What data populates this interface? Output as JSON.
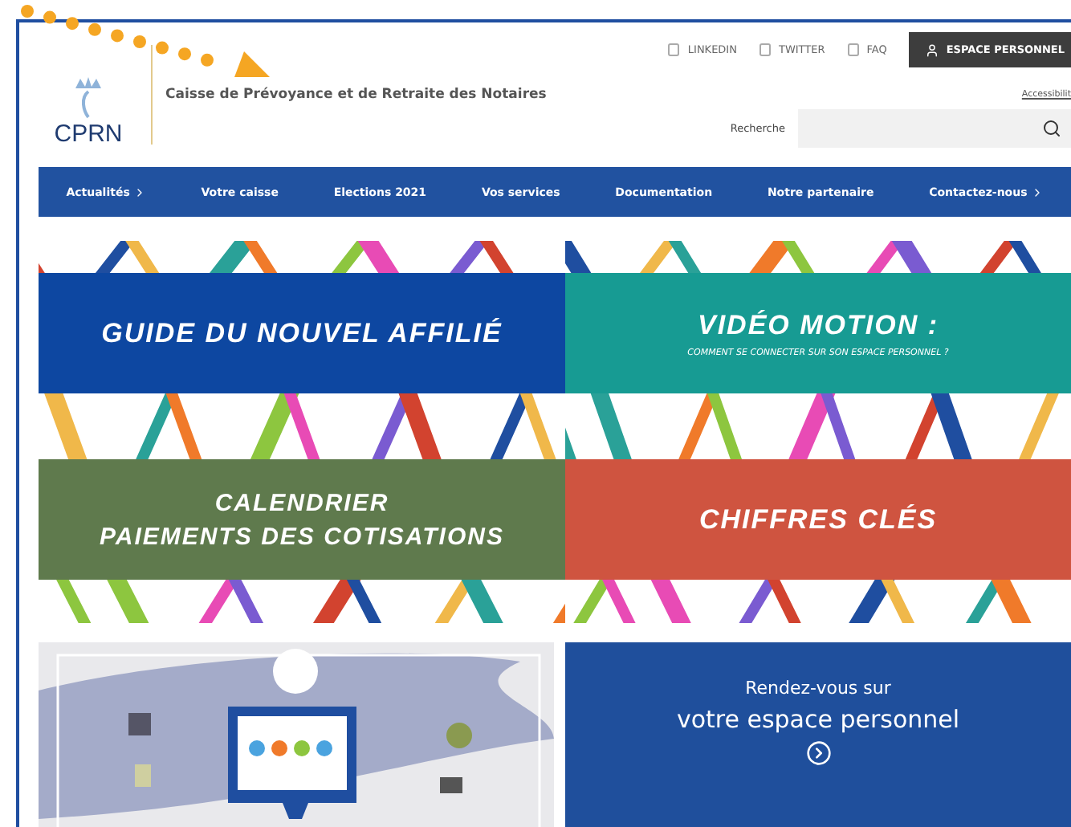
{
  "top_links": [
    {
      "label": "LINKEDIN"
    },
    {
      "label": "TWITTER"
    },
    {
      "label": "FAQ"
    }
  ],
  "account_button": {
    "label": "ESPACE PERSONNEL"
  },
  "logo": {
    "text": "CPRN"
  },
  "site_title": "Caisse de Prévoyance et de Retraite des Notaires",
  "accessibility_link": "Accessibilit",
  "search": {
    "label": "Recherche"
  },
  "nav": [
    {
      "label": "Actualités",
      "has_submenu": true
    },
    {
      "label": "Votre caisse",
      "has_submenu": false
    },
    {
      "label": "Elections 2021",
      "has_submenu": false
    },
    {
      "label": "Vos services",
      "has_submenu": false
    },
    {
      "label": "Documentation",
      "has_submenu": false
    },
    {
      "label": "Notre partenaire",
      "has_submenu": false
    },
    {
      "label": "Contactez-nous",
      "has_submenu": true
    }
  ],
  "tiles": [
    {
      "color": "#0d47a1",
      "lines": [
        "GUIDE DU NOUVEL AFFILIÉ"
      ]
    },
    {
      "color": "#179b93",
      "lines": [
        "VIDÉO MOTION :"
      ],
      "subtitle": "COMMENT SE CONNECTER SUR SON ESPACE PERSONNEL ?"
    },
    {
      "color": "#5f7a4d",
      "lines": [
        "CALENDRIER",
        "PAIEMENTS DES COTISATIONS"
      ]
    },
    {
      "color": "#cf5440",
      "lines": [
        "CHIFFRES CLÉS"
      ]
    }
  ],
  "promo": {
    "intro": "Rendez-vous sur",
    "headline": "votre espace personnel"
  }
}
